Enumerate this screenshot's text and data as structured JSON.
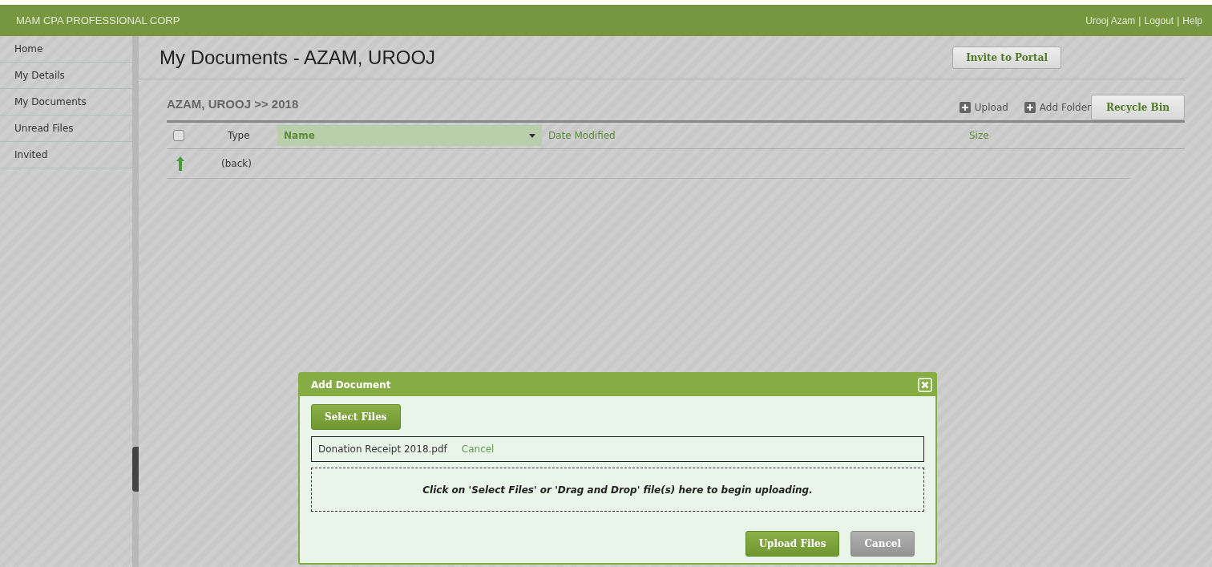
{
  "header": {
    "brand": "MAM CPA PROFESSIONAL CORP",
    "user_links": [
      {
        "label": "Urooj Azam"
      },
      {
        "label": "Logout"
      },
      {
        "label": "Help"
      }
    ],
    "separator": "|"
  },
  "sidebar": {
    "items": [
      {
        "label": "Home",
        "selected": false
      },
      {
        "label": "My Details",
        "selected": false
      },
      {
        "label": "My Documents",
        "selected": false
      },
      {
        "label": "Unread Files",
        "selected": false
      },
      {
        "label": "Invited",
        "selected": false
      }
    ]
  },
  "page": {
    "title": "My Documents - AZAM, UROOJ",
    "invite_button": "Invite to Portal"
  },
  "breadcrumb": "AZAM, UROOJ >> 2018",
  "toolbar": {
    "upload": "Upload",
    "add_folder": "Add Folder",
    "recycle_bin": "Recycle Bin"
  },
  "table": {
    "select_all_checked": false,
    "columns": [
      {
        "label": "Type",
        "sorted": false
      },
      {
        "label": "Name",
        "sorted": true
      },
      {
        "label": "Date Modified",
        "sorted": false
      },
      {
        "label": "Size",
        "sorted": false
      }
    ],
    "rows": [
      {
        "name": "(back)"
      }
    ]
  },
  "dialog": {
    "title": "Add Document",
    "select_button": "Select Files",
    "files": [
      {
        "name": "Donation Receipt 2018.pdf",
        "cancel": "Cancel"
      }
    ],
    "drop_hint": "Click on 'Select Files' or 'Drag and Drop' file(s) here to begin uploading.",
    "upload_button": "Upload Files",
    "cancel_button": "Cancel"
  }
}
